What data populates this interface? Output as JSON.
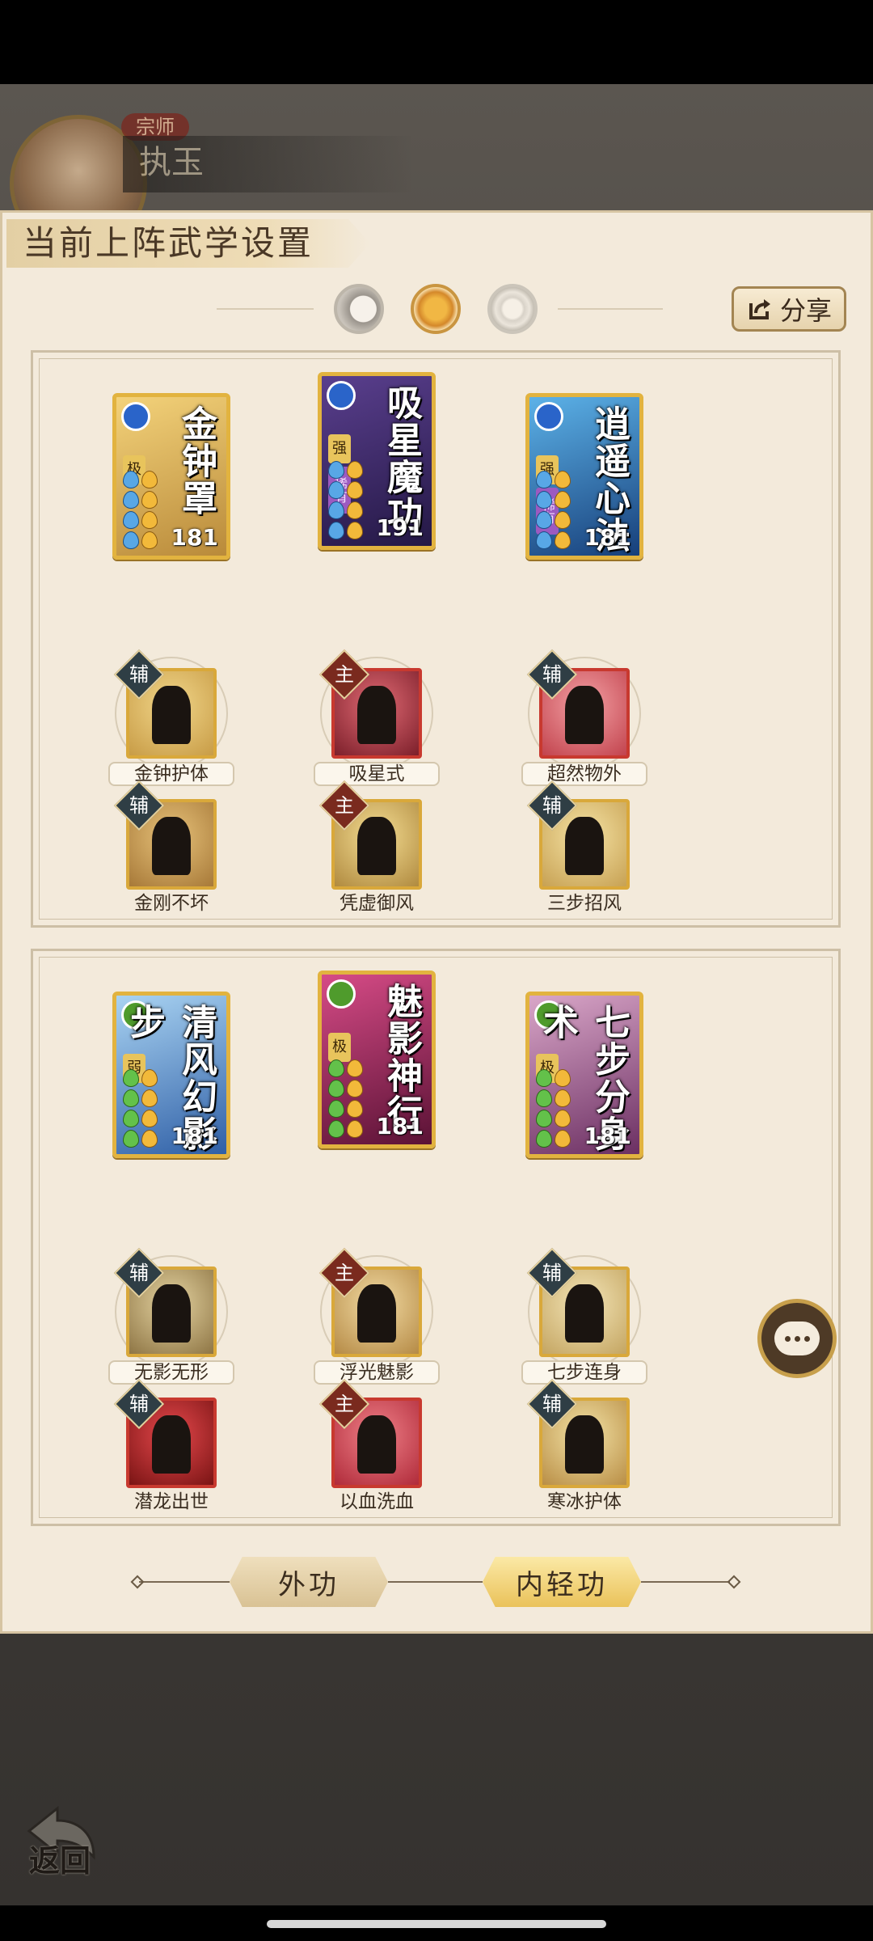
{
  "header": {
    "rank_badge": "宗师",
    "player_name": "执玉"
  },
  "panel": {
    "title": "当前上阵武学设置",
    "share_label": "分享"
  },
  "mode_selector": {
    "options": [
      "moon",
      "sun",
      "ring"
    ],
    "selected": "sun"
  },
  "sections": [
    {
      "slots": [
        {
          "card": {
            "name": "金钟罩",
            "power": "181",
            "type": "blue",
            "grade": "极",
            "rare": "",
            "theme": [
              "#f3d27a",
              "#b98a3a"
            ]
          },
          "techs": [
            {
              "tag": "辅",
              "label": "金钟护体",
              "theme": [
                "#f1d68a",
                "#c89c46"
              ],
              "frame": "gold",
              "labeled": true
            },
            {
              "tag": "辅",
              "label": "金刚不坏",
              "theme": [
                "#e7c27a",
                "#a77938"
              ],
              "frame": "gold",
              "labeled": false
            }
          ]
        },
        {
          "card": {
            "name": "吸星魔功",
            "power": "191",
            "type": "blue",
            "grade": "强",
            "rare": "稀有",
            "theme": [
              "#5a3f8e",
              "#241845"
            ]
          },
          "techs": [
            {
              "tag": "主",
              "label": "吸星式",
              "theme": [
                "#e06a74",
                "#7c1f2a"
              ],
              "frame": "red",
              "labeled": true
            },
            {
              "tag": "主",
              "label": "凭虚御风",
              "theme": [
                "#f4dd93",
                "#b08a3f"
              ],
              "frame": "gold",
              "labeled": false
            }
          ]
        },
        {
          "card": {
            "name": "逍遥心法",
            "power": "181",
            "type": "blue",
            "grade": "强",
            "rare": "稀有",
            "theme": [
              "#5cb2e8",
              "#173f7a"
            ]
          },
          "techs": [
            {
              "tag": "辅",
              "label": "超然物外",
              "theme": [
                "#f3a1a5",
                "#c2434d"
              ],
              "frame": "red",
              "labeled": true
            },
            {
              "tag": "辅",
              "label": "三步招风",
              "theme": [
                "#f5e3a5",
                "#c7a153"
              ],
              "frame": "gold",
              "labeled": false
            }
          ]
        }
      ]
    },
    {
      "slots": [
        {
          "card": {
            "name": "清风幻影步",
            "power": "181",
            "type": "green",
            "grade": "弱",
            "rare": "",
            "theme": [
              "#a9d3f2",
              "#2f5fa6"
            ]
          },
          "techs": [
            {
              "tag": "辅",
              "label": "无影无形",
              "theme": [
                "#e4d3a1",
                "#8e7544"
              ],
              "frame": "gold",
              "labeled": true
            },
            {
              "tag": "辅",
              "label": "潜龙出世",
              "theme": [
                "#e5484c",
                "#7a1414"
              ],
              "frame": "red",
              "labeled": false
            }
          ]
        },
        {
          "card": {
            "name": "魅影神行",
            "power": "181",
            "type": "green",
            "grade": "极",
            "rare": "",
            "theme": [
              "#d64b86",
              "#5a1235"
            ]
          },
          "techs": [
            {
              "tag": "主",
              "label": "浮光魅影",
              "theme": [
                "#f2dba4",
                "#b58a45"
              ],
              "frame": "gold",
              "labeled": true
            },
            {
              "tag": "主",
              "label": "以血洗血",
              "theme": [
                "#ef8088",
                "#b02b3a"
              ],
              "frame": "red",
              "labeled": false
            }
          ]
        },
        {
          "card": {
            "name": "七步分身术",
            "power": "181",
            "type": "green",
            "grade": "极",
            "rare": "",
            "theme": [
              "#d9a6c8",
              "#6b2f62"
            ]
          },
          "techs": [
            {
              "tag": "辅",
              "label": "七步连身",
              "theme": [
                "#f3e5b8",
                "#c4a561"
              ],
              "frame": "gold",
              "labeled": true
            },
            {
              "tag": "辅",
              "label": "寒冰护体",
              "theme": [
                "#f3e3a7",
                "#b98e45"
              ],
              "frame": "gold",
              "labeled": false
            }
          ]
        }
      ]
    }
  ],
  "tabs": [
    {
      "label": "外功",
      "selected": false
    },
    {
      "label": "内轻功",
      "selected": true
    }
  ],
  "back_label": "返回"
}
